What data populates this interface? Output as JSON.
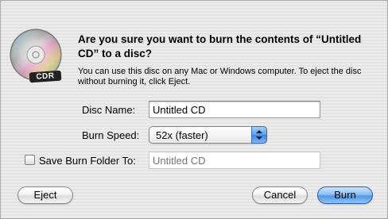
{
  "dialog": {
    "heading": "Are you sure you want to burn the contents of “Untitled CD” to a disc?",
    "message": "You can use this disc on any Mac or Windows computer. To eject the disc without burning it, click Eject.",
    "icon": {
      "name": "cdr-disc-icon",
      "label": "CDR"
    }
  },
  "form": {
    "disc_name": {
      "label": "Disc Name:",
      "value": "Untitled CD"
    },
    "burn_speed": {
      "label": "Burn Speed:",
      "selected": "52x (faster)"
    },
    "save_folder": {
      "label": "Save Burn Folder To:",
      "checked": false,
      "placeholder": "Untitled CD",
      "enabled": false
    }
  },
  "buttons": {
    "eject": "Eject",
    "cancel": "Cancel",
    "burn": "Burn"
  },
  "colors": {
    "default_button": "#5b9de6",
    "background": "#ececec"
  }
}
